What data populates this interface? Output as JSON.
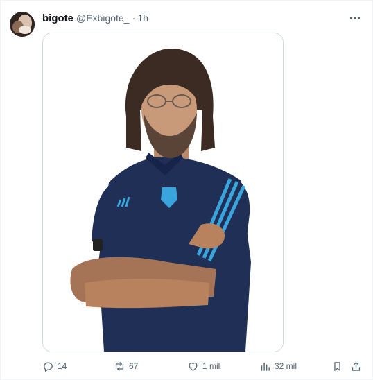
{
  "tweet": {
    "author_name": "bigote",
    "author_handle": "@Exbigote_",
    "separator": "·",
    "timestamp": "1h",
    "more_icon": "more-horizontal-icon"
  },
  "media": {
    "type": "photo",
    "subject_colors": {
      "shirt": "#1f2f55",
      "stripes": "#3aa4dc",
      "background": "#ffffff"
    }
  },
  "actions": {
    "reply_count": "14",
    "repost_count": "67",
    "like_count": "1 mil",
    "views_count": "32 mil"
  },
  "colors": {
    "text_primary": "#0f1419",
    "text_secondary": "#536471",
    "border": "#cfd9de"
  }
}
